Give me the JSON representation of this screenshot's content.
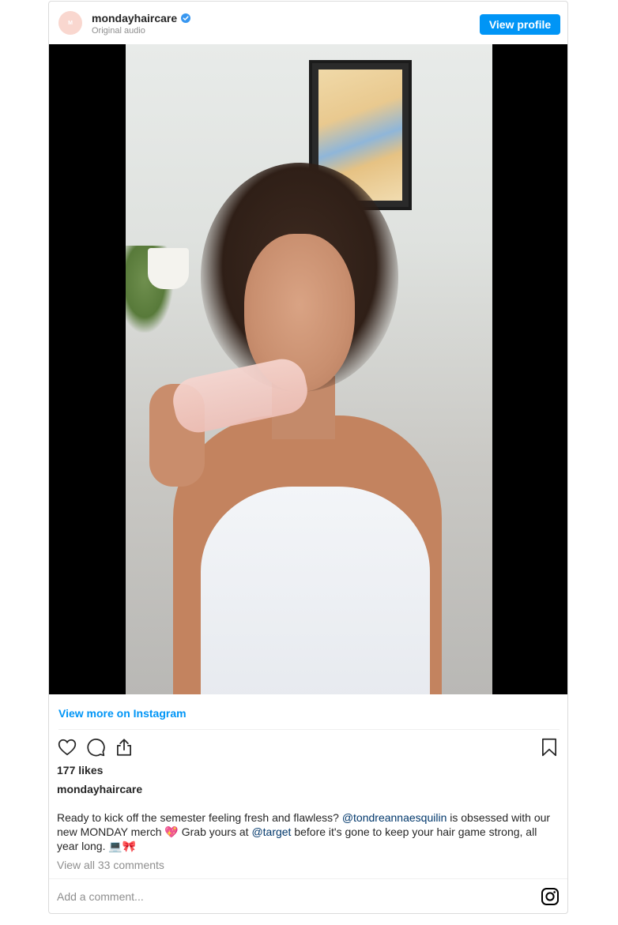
{
  "header": {
    "username": "mondayhaircare",
    "subtitle": "Original audio",
    "avatar_text": "M",
    "view_profile_label": "View profile"
  },
  "media": {
    "type": "video"
  },
  "footer": {
    "view_more_label": "View more on Instagram",
    "likes": "177 likes",
    "author": "mondayhaircare",
    "caption": {
      "part1": "Ready to kick off the semester feeling fresh and flawless? ",
      "mention1": "@tondreannaesquilin",
      "part2": " is obsessed with our new MONDAY merch 💖 Grab yours at ",
      "mention2": "@target",
      "part3": " before it's gone to keep your hair game strong, all year long. 💻🎀"
    },
    "view_comments": "View all 33 comments",
    "comment_placeholder": "Add a comment..."
  },
  "icons": {
    "verified": "verified-badge-icon",
    "like": "heart-icon",
    "comment": "comment-icon",
    "share": "share-icon",
    "save": "bookmark-icon",
    "instagram": "instagram-icon"
  },
  "colors": {
    "primary_button": "#0095f6",
    "link": "#0095f6",
    "mention": "#00376b",
    "muted": "#8e8e8e",
    "avatar_bg": "#f9d7cf"
  }
}
